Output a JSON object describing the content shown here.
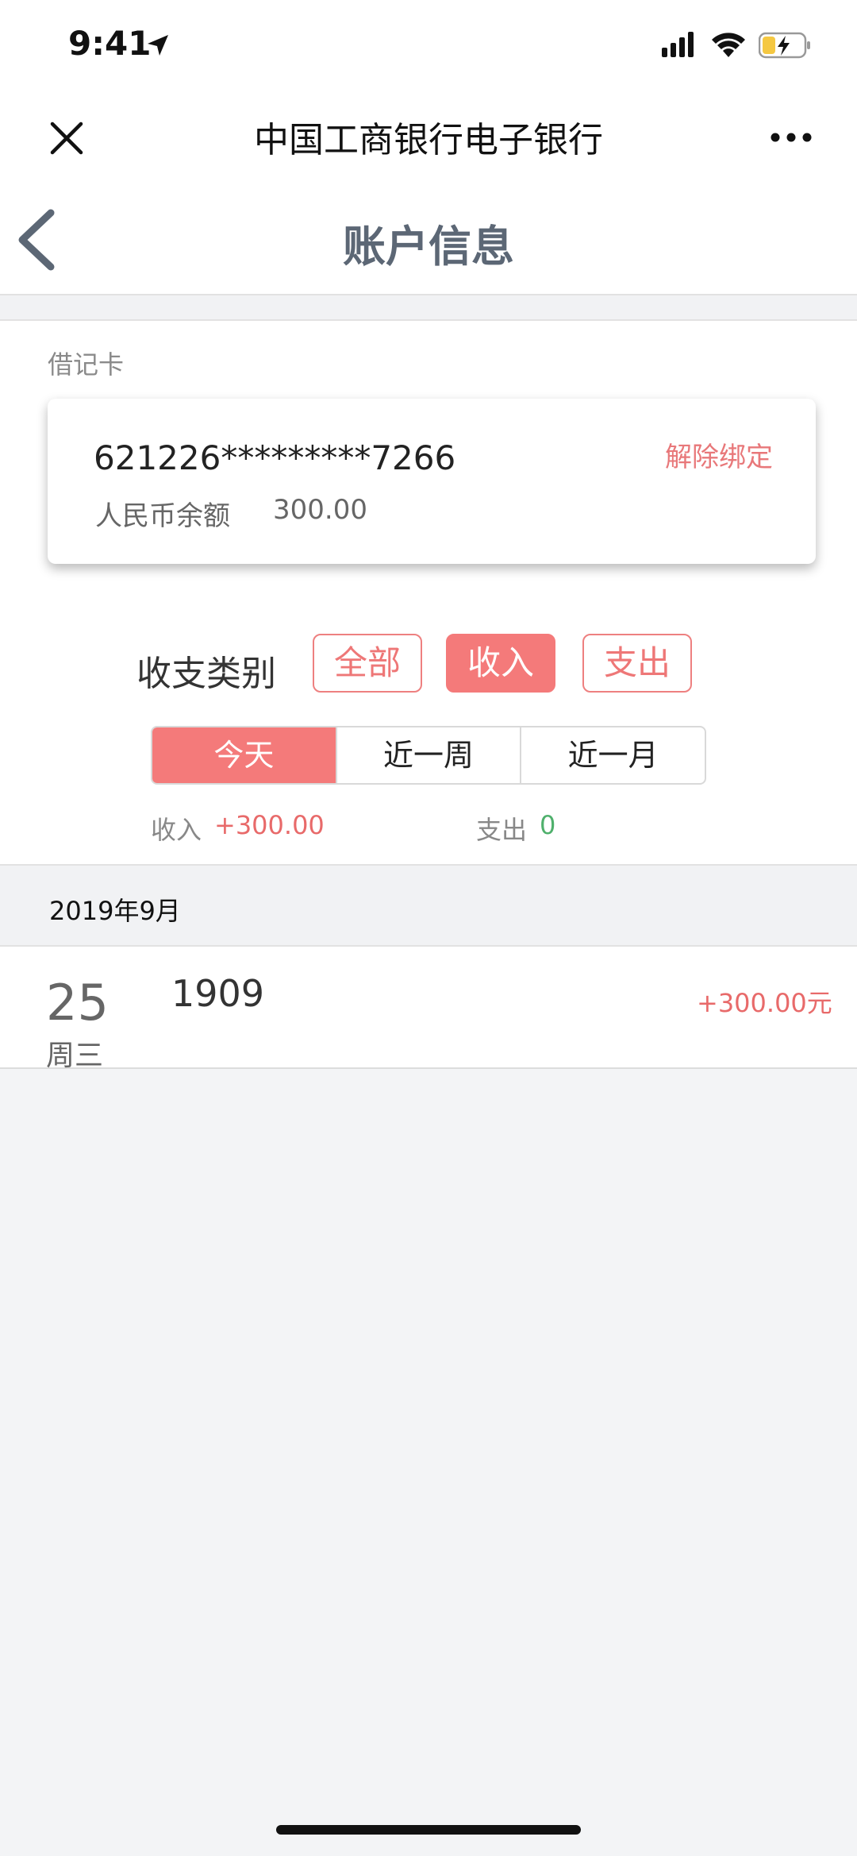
{
  "status_bar": {
    "time": "9:41"
  },
  "wechat_nav": {
    "title": "中国工商银行电子银行"
  },
  "page": {
    "title": "账户信息"
  },
  "card_section": {
    "label": "借记卡",
    "card_number": "621226*********7266",
    "unbind_label": "解除绑定",
    "balance_label": "人民币余额",
    "balance_value": "300.00"
  },
  "filter": {
    "type_label": "收支类别",
    "types": [
      {
        "label": "全部",
        "active": false
      },
      {
        "label": "收入",
        "active": true
      },
      {
        "label": "支出",
        "active": false
      }
    ],
    "periods": [
      {
        "label": "今天",
        "active": true
      },
      {
        "label": "近一周",
        "active": false
      },
      {
        "label": "近一月",
        "active": false
      }
    ]
  },
  "summary": {
    "income_label": "收入",
    "income_value": "+300.00",
    "expense_label": "支出",
    "expense_value": "0"
  },
  "transactions": {
    "month": "2019年9月",
    "items": [
      {
        "day": "25",
        "weekday": "周三",
        "name": "1909",
        "amount": "+300.00元"
      }
    ]
  },
  "colors": {
    "accent": "#f47a7a",
    "income": "#e86a6a",
    "expense": "#4fb06c",
    "title_gray": "#5c6775"
  }
}
